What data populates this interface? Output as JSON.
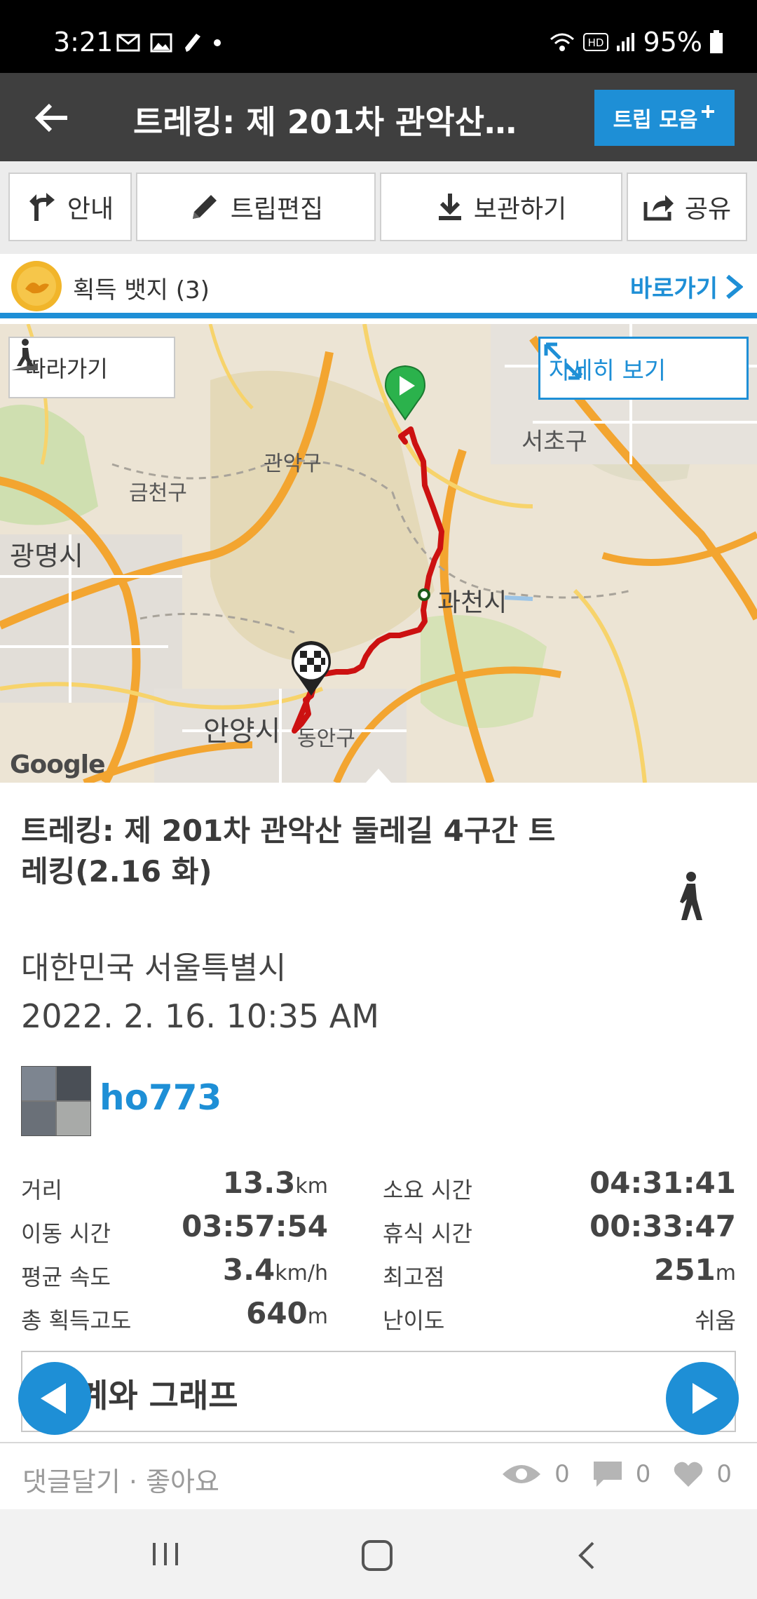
{
  "status": {
    "time": "3:21",
    "battery": "95%"
  },
  "appbar": {
    "title": "트레킹: 제 201차 관악산…",
    "trip_collection": "트립 모음"
  },
  "toolbar": {
    "guide": "안내",
    "edit": "트립편집",
    "save": "보관하기",
    "share": "공유"
  },
  "badges": {
    "label": "획득 뱃지 (3)",
    "go": "바로가기"
  },
  "map": {
    "follow": "따라가기",
    "detail": "자세히 보기",
    "google": "Google",
    "places": [
      "관악구",
      "서초구",
      "금천구",
      "광명시",
      "과천시",
      "안양시",
      "동안구"
    ]
  },
  "trip": {
    "title": "트레킹: 제 201차 관악산 둘레길 4구간 트레킹(2.16 화)",
    "location": "대한민국 서울특별시",
    "date": "2022. 2. 16. 10:35 AM",
    "user": "ho773"
  },
  "stats": [
    {
      "label": "거리",
      "value": "13.3",
      "unit": "km",
      "label2": "소요 시간",
      "value2": "04:31:41",
      "unit2": ""
    },
    {
      "label": "이동 시간",
      "value": "03:57:54",
      "unit": "",
      "label2": "휴식 시간",
      "value2": "00:33:47",
      "unit2": ""
    },
    {
      "label": "평균 속도",
      "value": "3.4",
      "unit": "km/h",
      "label2": "최고점",
      "value2": "251",
      "unit2": "m"
    },
    {
      "label": "총 획득고도",
      "value": "640",
      "unit": "m",
      "label2": "난이도",
      "value2": "쉬움",
      "unit2": ""
    }
  ],
  "graph": {
    "title": "계와 그래프"
  },
  "social": {
    "label": "댓글달기 · 좋아요",
    "views": "0",
    "comments": "0",
    "likes": "0"
  },
  "colors": {
    "accent": "#1e8fd6",
    "appbar": "#3f3f3f",
    "route": "#cc1111"
  }
}
